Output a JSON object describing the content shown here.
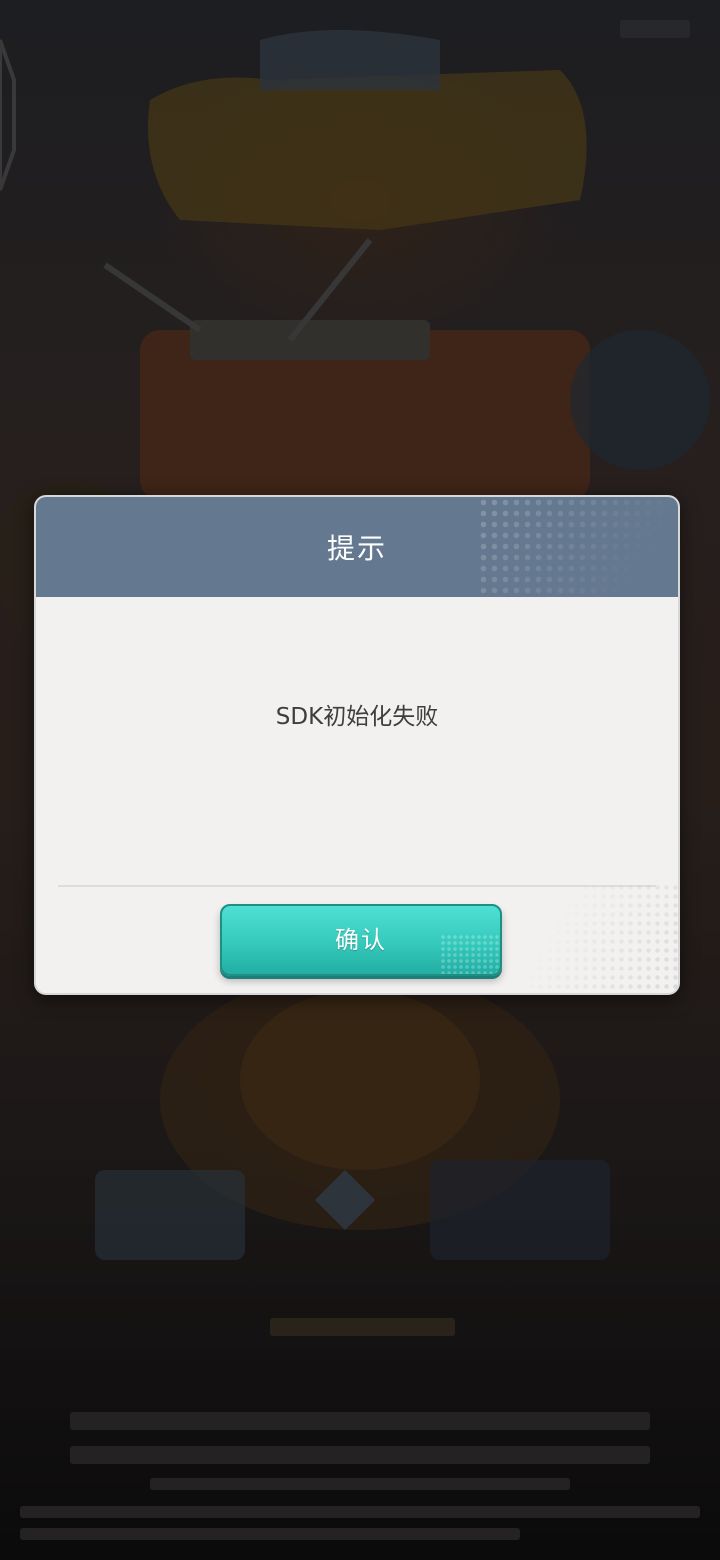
{
  "dialog": {
    "title": "提示",
    "message": "SDK初始化失败",
    "confirm_label": "确认"
  },
  "colors": {
    "header": "#64788f",
    "dialog_body": "#f2f1ef",
    "button_accent": "#35c9bc"
  },
  "background": {
    "description_icon": "game-splash-artwork"
  }
}
